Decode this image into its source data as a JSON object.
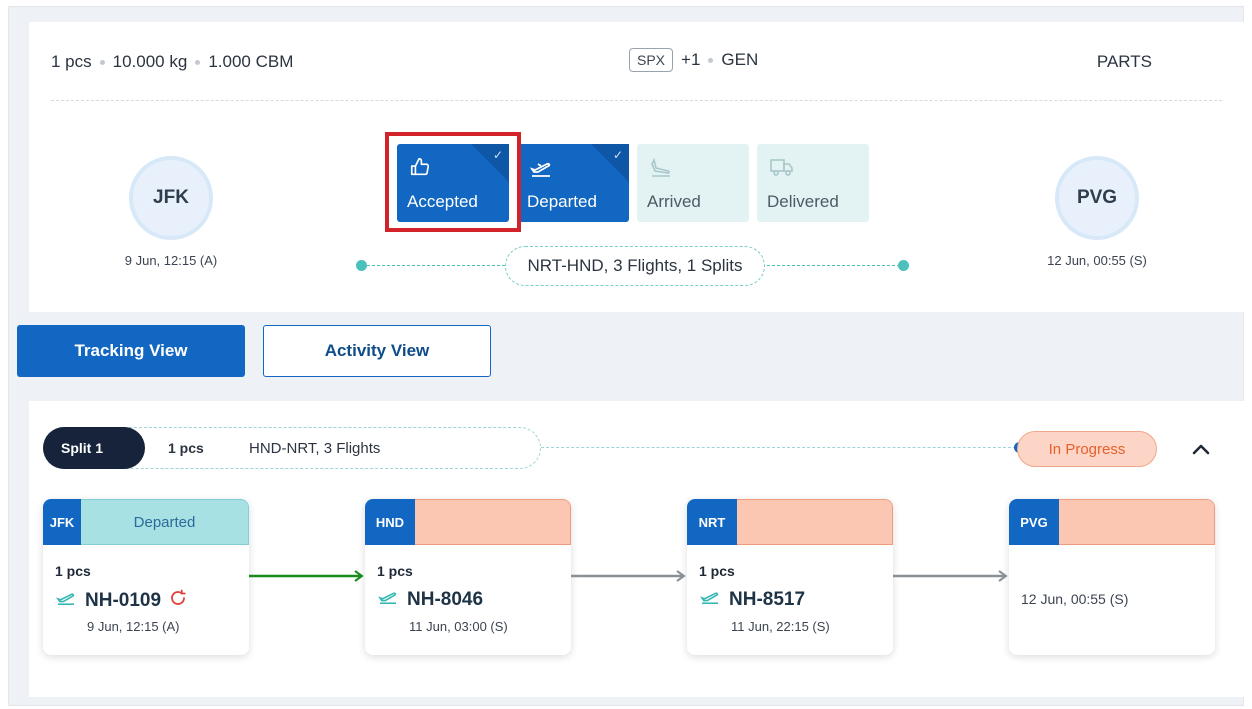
{
  "summary": {
    "pieces": "1 pcs",
    "weight": "10.000 kg",
    "volume": "1.000 CBM",
    "shc_tag": "SPX",
    "shc_more": "+1",
    "product": "GEN",
    "commodity": "PARTS",
    "origin": {
      "code": "JFK",
      "time": "9 Jun, 12:15 (A)"
    },
    "destination": {
      "code": "PVG",
      "time": "12 Jun, 00:55 (S)"
    },
    "statuses": [
      {
        "label": "Accepted",
        "icon": "thumbs-up-icon",
        "state": "done",
        "highlighted": true
      },
      {
        "label": "Departed",
        "icon": "plane-departure-icon",
        "state": "done"
      },
      {
        "label": "Arrived",
        "icon": "plane-arrival-icon",
        "state": "pending"
      },
      {
        "label": "Delivered",
        "icon": "delivery-truck-icon",
        "state": "pending"
      }
    ],
    "route_summary": "NRT-HND, 3 Flights, 1 Splits"
  },
  "views": {
    "tracking_label": "Tracking View",
    "activity_label": "Activity View",
    "active": "tracking"
  },
  "split": {
    "tag": "Split 1",
    "pieces": "1 pcs",
    "route": "HND-NRT, 3 Flights",
    "status": "In Progress",
    "legs": [
      {
        "code": "JFK",
        "status": "Departed",
        "pieces": "1 pcs",
        "flight": "NH-0109",
        "time": "9 Jun, 12:15 (A)",
        "refresh_icon": true
      },
      {
        "code": "HND",
        "status": "",
        "pieces": "1 pcs",
        "flight": "NH-8046",
        "time": "11 Jun, 03:00 (S)"
      },
      {
        "code": "NRT",
        "status": "",
        "pieces": "1 pcs",
        "flight": "NH-8517",
        "time": "11 Jun, 22:15 (S)"
      },
      {
        "code": "PVG",
        "status": "",
        "time": "12 Jun, 00:55 (S)"
      }
    ]
  },
  "colors": {
    "primary": "#1267c2",
    "teal": "#4cc0bb",
    "in_progress": "#e8602c",
    "highlight": "#d2232a",
    "connector_done": "#1a8a1a",
    "connector_pending": "#8a8f94"
  }
}
